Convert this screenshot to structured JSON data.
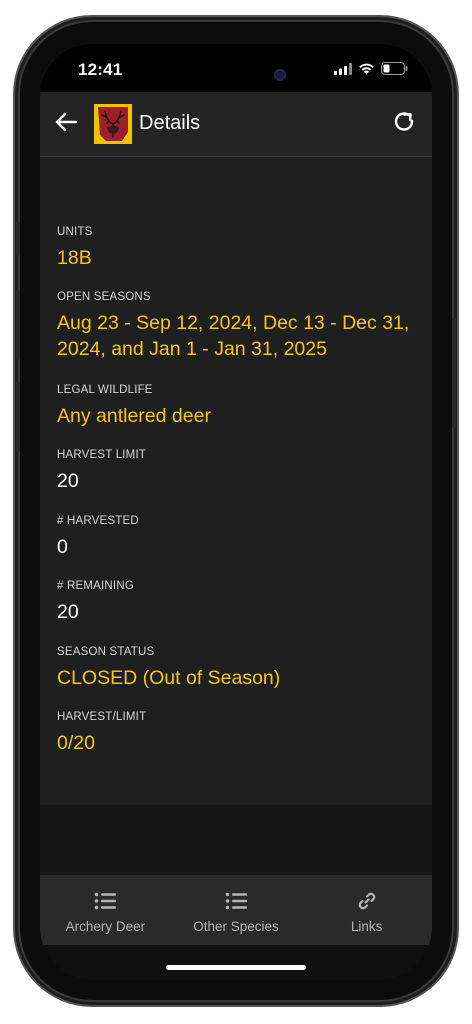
{
  "status": {
    "time": "12:41"
  },
  "appbar": {
    "title": "Details",
    "back_icon": "arrow-left-icon",
    "refresh_icon": "refresh-icon"
  },
  "fields": {
    "units": {
      "label": "UNITS",
      "value": "18B"
    },
    "open_seasons": {
      "label": "OPEN SEASONS",
      "value": "Aug 23 - Sep 12, 2024, Dec 13 - Dec 31, 2024, and Jan 1 - Jan 31, 2025"
    },
    "legal_wildlife": {
      "label": "LEGAL WILDLIFE",
      "value": "Any antlered deer"
    },
    "harvest_limit": {
      "label": "HARVEST LIMIT",
      "value": "20"
    },
    "harvested": {
      "label": "# HARVESTED",
      "value": "0"
    },
    "remaining": {
      "label": "# REMAINING",
      "value": "20"
    },
    "season_status": {
      "label": "SEASON STATUS",
      "value": "CLOSED (Out of Season)"
    },
    "harvest_ratio": {
      "label": "HARVEST/LIMIT",
      "value": "0/20"
    }
  },
  "tabs": [
    {
      "label": "Archery Deer",
      "icon": "list-icon"
    },
    {
      "label": "Other Species",
      "icon": "list-icon"
    },
    {
      "label": "Links",
      "icon": "link-icon"
    }
  ],
  "colors": {
    "accent": "#f5c518",
    "background": "#1f1f1f",
    "appbar": "#242424",
    "tabbar": "#2a2a2a"
  }
}
